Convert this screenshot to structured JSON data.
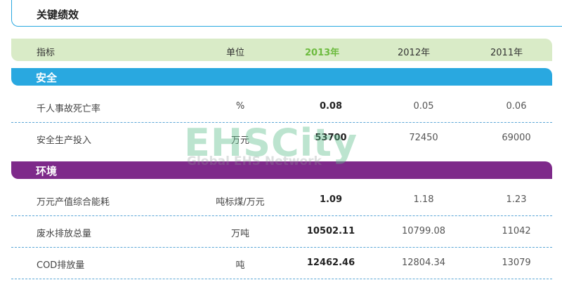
{
  "page": {
    "title": "关键绩效"
  },
  "header": {
    "indicator": "指标",
    "unit": "单位",
    "years": [
      "2013年",
      "2012年",
      "2011年"
    ]
  },
  "colors": {
    "accent_blue": "#29a8e0",
    "accent_purple": "#7e2a8a",
    "header_green": "#d9ebc7",
    "highlight_green": "#6dbb3f"
  },
  "sections": [
    {
      "name": "安全",
      "rows": [
        {
          "name": "千人事故死亡率",
          "unit": "%",
          "y2013": "0.08",
          "y2012": "0.05",
          "y2011": "0.06"
        },
        {
          "name": "安全生产投入",
          "unit": "万元",
          "y2013": "53700",
          "y2012": "72450",
          "y2011": "69000"
        }
      ]
    },
    {
      "name": "环境",
      "rows": [
        {
          "name": "万元产值综合能耗",
          "unit": "吨标煤/万元",
          "y2013": "1.09",
          "y2012": "1.18",
          "y2011": "1.23"
        },
        {
          "name": "废水排放总量",
          "unit": "万吨",
          "y2013": "10502.11",
          "y2012": "10799.08",
          "y2011": "11042"
        },
        {
          "name": "COD排放量",
          "unit": "吨",
          "y2013": "12462.46",
          "y2012": "12804.34",
          "y2011": "13079"
        }
      ]
    }
  ],
  "watermark": {
    "main": "EHSCity",
    "sub": "Global EHS Network"
  }
}
